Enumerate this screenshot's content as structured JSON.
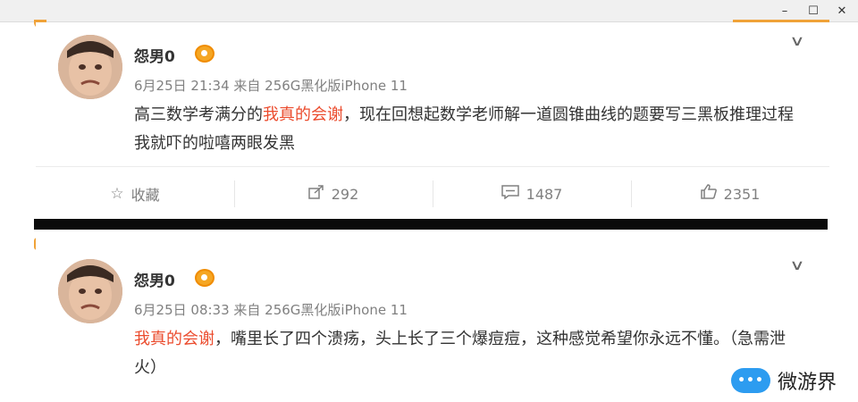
{
  "window": {
    "minimize_glyph": "–",
    "maximize_glyph": "☐",
    "close_glyph": "✕"
  },
  "posts": [
    {
      "username": "怨男0",
      "meta": "6月25日 21:34 来自 256G黑化版iPhone 11",
      "content_topic": "我真的会谢",
      "content_before": "高三数学考满分的",
      "content_after": "，现在回想起数学老师解一道圆锥曲线的题要写三黑板推理过程我就吓的啦嘻两眼发黑",
      "actions": {
        "favorite_label": "收藏",
        "repost_count": "292",
        "comment_count": "1487",
        "like_count": "2351"
      }
    },
    {
      "username": "怨男0",
      "meta": "6月25日 08:33 来自 256G黑化版iPhone 11",
      "content_topic": "我真的会谢",
      "content_after": "，嘴里长了四个溃疡，头上长了三个爆痘痘，这种感觉希望你永远不懂。（急需泄火）"
    }
  ],
  "icons": {
    "favorite": "star-outline-icon",
    "repost": "share-box-icon",
    "comment": "comment-box-icon",
    "like": "thumbs-up-icon",
    "more": "chevron-down-icon"
  },
  "watermark": {
    "logo_text": "•••",
    "text": "微游界"
  },
  "colors": {
    "topic": "#eb4c2e",
    "meta": "#808080",
    "separator": "#0b0b0b",
    "sticker": "#f0a238",
    "watermark_logo": "#2d9cf0"
  }
}
